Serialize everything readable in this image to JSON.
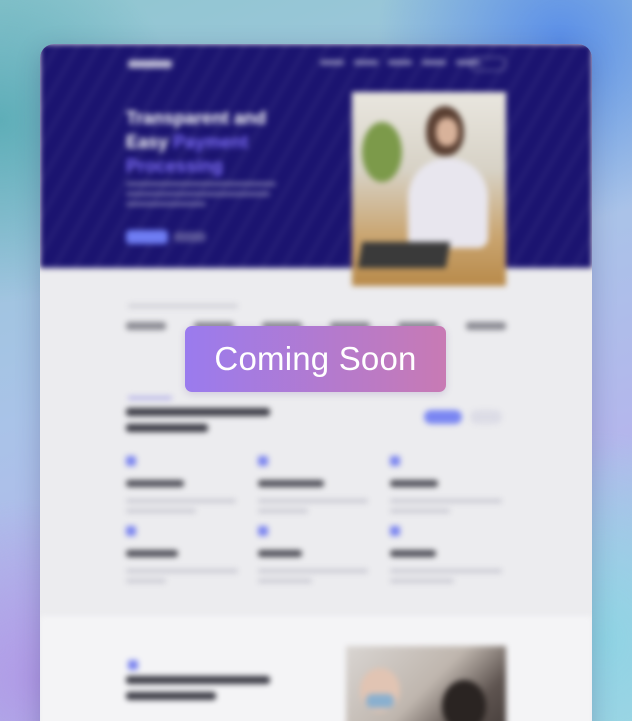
{
  "preview": {
    "hero": {
      "title_line1": "Transparent and",
      "title_word": "Easy",
      "title_accent": "Payment Processing"
    }
  },
  "overlay": {
    "badge_label": "Coming Soon"
  },
  "colors": {
    "hero_background": "#1b1470",
    "accent": "#7c6cf6",
    "badge_gradient_start": "#9a7bee",
    "badge_gradient_end": "#c87ab4"
  }
}
